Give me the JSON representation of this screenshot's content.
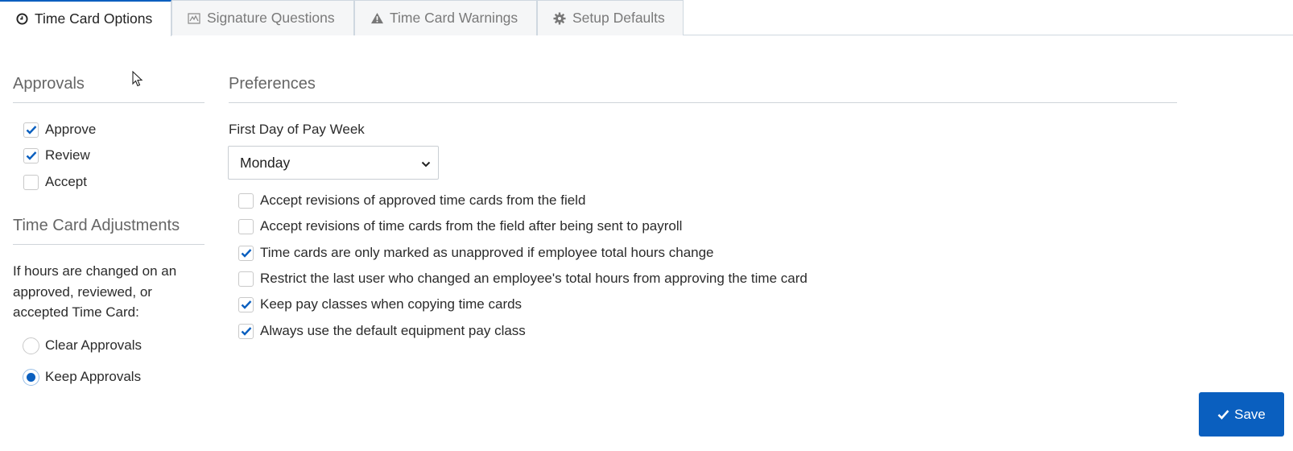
{
  "tabs": [
    {
      "label": "Time Card Options",
      "icon": "clock-icon",
      "active": true
    },
    {
      "label": "Signature Questions",
      "icon": "signature-icon",
      "active": false
    },
    {
      "label": "Time Card Warnings",
      "icon": "warning-icon",
      "active": false
    },
    {
      "label": "Setup Defaults",
      "icon": "gear-icon",
      "active": false
    }
  ],
  "approvals": {
    "title": "Approvals",
    "items": [
      {
        "label": "Approve",
        "checked": true
      },
      {
        "label": "Review",
        "checked": true
      },
      {
        "label": "Accept",
        "checked": false
      }
    ]
  },
  "adjustments": {
    "title": "Time Card Adjustments",
    "description": "If hours are changed on an approved, reviewed, or accepted Time Card:",
    "options": [
      {
        "label": "Clear Approvals",
        "selected": false
      },
      {
        "label": "Keep Approvals",
        "selected": true
      }
    ]
  },
  "preferences": {
    "title": "Preferences",
    "first_day_label": "First Day of Pay Week",
    "first_day_value": "Monday",
    "options": [
      {
        "label": "Accept revisions of approved time cards from the field",
        "checked": false
      },
      {
        "label": "Accept revisions of time cards from the field after being sent to payroll",
        "checked": false
      },
      {
        "label": "Time cards are only marked as unapproved if employee total hours change",
        "checked": true
      },
      {
        "label": "Restrict the last user who changed an employee's total hours from approving the time card",
        "checked": false
      },
      {
        "label": "Keep pay classes when copying time cards",
        "checked": true
      },
      {
        "label": "Always use the default equipment pay class",
        "checked": true
      }
    ]
  },
  "save_label": "Save",
  "colors": {
    "accent": "#0a5fbf",
    "border": "#cfd8e0"
  }
}
